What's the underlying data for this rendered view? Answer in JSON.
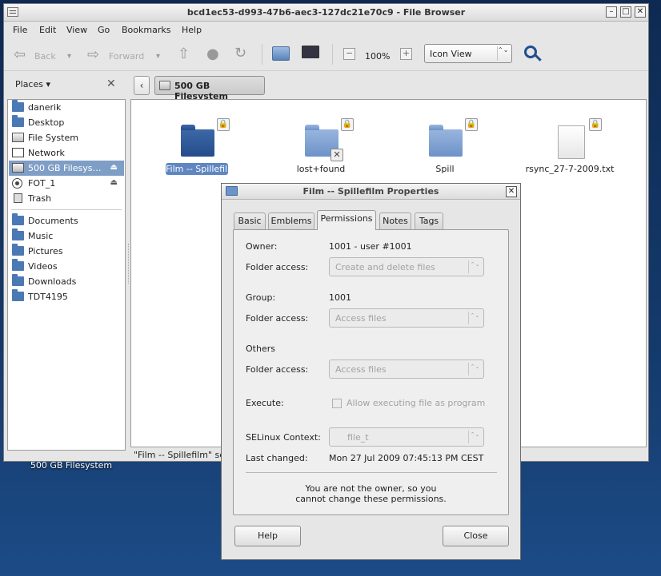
{
  "desktop": {
    "icon_label": "500 GB Filesystem"
  },
  "window": {
    "title": "bcd1ec53-d993-47b6-aec3-127dc21e70c9 - File Browser",
    "controls": {
      "minimize": "–",
      "maximize": "□",
      "close": "✕"
    }
  },
  "menubar": [
    "File",
    "Edit",
    "View",
    "Go",
    "Bookmarks",
    "Help"
  ],
  "toolbar": {
    "back": "Back",
    "forward": "Forward",
    "zoom_out": "−",
    "zoom_level": "100%",
    "zoom_in": "+",
    "view_mode": "Icon View",
    "dropdown_glyph": "⌃⌄",
    "search_icon": "search-icon"
  },
  "location": {
    "places_label": "Places",
    "places_close": "✕",
    "back_glyph": "‹",
    "path_button": "500 GB Filesystem"
  },
  "sidebar": {
    "eject_glyph": "⏏",
    "items": [
      {
        "label": "danerik",
        "icon": "home-icon"
      },
      {
        "label": "Desktop",
        "icon": "desktop-icon"
      },
      {
        "label": "File System",
        "icon": "drive-icon"
      },
      {
        "label": "Network",
        "icon": "network-icon"
      },
      {
        "label": "500 GB Filesys…",
        "icon": "drive-icon",
        "selected": true
      },
      {
        "label": "FOT_1",
        "icon": "disc-icon"
      },
      {
        "label": "Trash",
        "icon": "trash-icon"
      },
      {
        "label": "Documents",
        "icon": "folder-icon"
      },
      {
        "label": "Music",
        "icon": "folder-icon"
      },
      {
        "label": "Pictures",
        "icon": "folder-icon"
      },
      {
        "label": "Videos",
        "icon": "folder-icon"
      },
      {
        "label": "Downloads",
        "icon": "folder-icon"
      },
      {
        "label": "TDT4195",
        "icon": "folder-icon"
      }
    ]
  },
  "files": {
    "lock_glyph": "🔒",
    "unreadable_glyph": "✕",
    "items": [
      {
        "name": "Film -- Spillefilm",
        "type": "folder",
        "selected": true
      },
      {
        "name": "lost+found",
        "type": "folder"
      },
      {
        "name": "Spill",
        "type": "folder"
      },
      {
        "name": "rsync_27-7-2009.txt",
        "type": "text-file"
      }
    ]
  },
  "statusbar": {
    "text": "\"Film -- Spillefilm\" se"
  },
  "dialog": {
    "title": "Film -- Spillefilm Properties",
    "close_glyph": "✕",
    "tabs": [
      "Basic",
      "Emblems",
      "Permissions",
      "Notes",
      "Tags"
    ],
    "active_tab": "Permissions",
    "owner_label": "Owner:",
    "owner_value": "1001 - user #1001",
    "folder_access_label": "Folder access:",
    "owner_access": "Create and delete files",
    "group_label": "Group:",
    "group_value": "1001",
    "group_access": "Access files",
    "others_label": "Others",
    "others_access": "Access files",
    "execute_label": "Execute:",
    "execute_option": "Allow executing file as program",
    "selinux_label": "SELinux Context:",
    "selinux_value": "file_t",
    "last_changed_label": "Last changed:",
    "last_changed_value": "Mon 27 Jul 2009 07:45:13 PM CEST",
    "note_line1": "You are not the owner, so you",
    "note_line2": "cannot change these permissions.",
    "help_button": "Help",
    "close_button": "Close",
    "combo_glyph": "⌃⌄"
  }
}
